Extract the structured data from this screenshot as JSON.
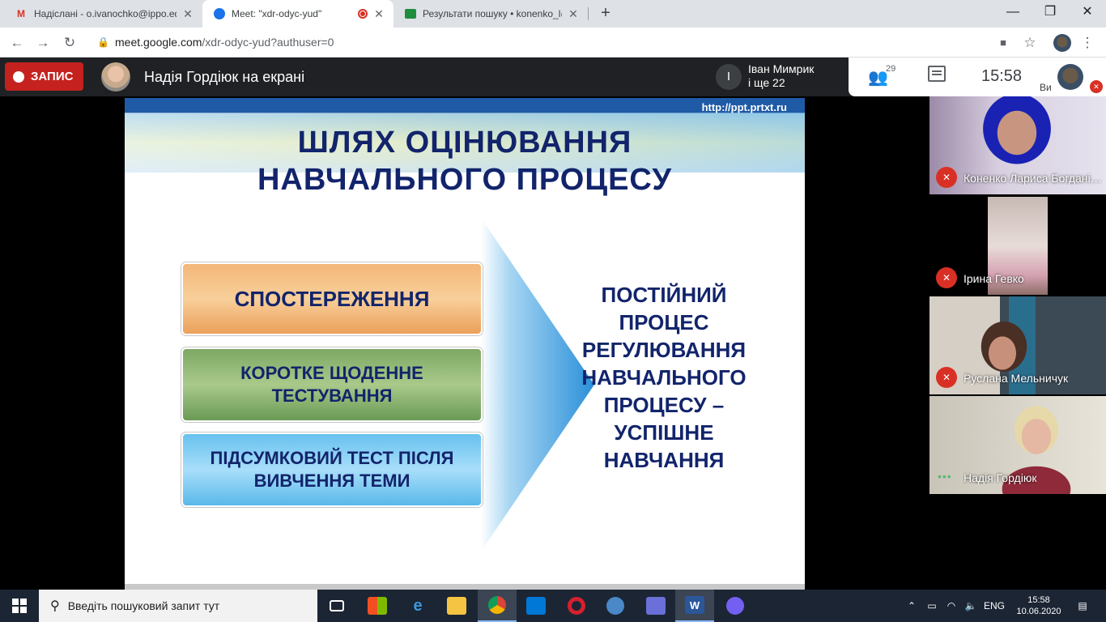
{
  "tabs": [
    {
      "title": "Надіслані - o.ivanochko@ippo.edu",
      "icon": "gmail-icon"
    },
    {
      "title": "Meet: \"xdr-odyc-yud\"",
      "icon": "meet-icon",
      "recording": true
    },
    {
      "title": "Результати пошуку • konenko_l@",
      "icon": "classroom-icon"
    }
  ],
  "address": {
    "host": "meet.google.com",
    "path": "/xdr-odyc-yud?authuser=0"
  },
  "meet": {
    "record_label": "ЗАПИС",
    "presenting_label": "Надія Гордіюк на екрані",
    "speaker_initial": "І",
    "speaker_name_line1": "Іван Мимрик",
    "speaker_name_line2": "і ще 22",
    "people_count": "29",
    "time": "15:58",
    "you_label": "Ви"
  },
  "slide": {
    "url": "http://ppt.prtxt.ru",
    "title_line1": "ШЛЯХ ОЦІНЮВАННЯ",
    "title_line2": "НАВЧАЛЬНОГО ПРОЦЕСУ",
    "box1": "СПОСТЕРЕЖЕННЯ",
    "box2_line1": "КОРОТКЕ ЩОДЕННЕ",
    "box2_line2": "ТЕСТУВАННЯ",
    "box3_line1": "ПІДСУМКОВИЙ ТЕСТ ПІСЛЯ",
    "box3_line2": "ВИВЧЕННЯ ТЕМИ",
    "result_lines": [
      "ПОСТІЙНИЙ",
      "ПРОЦЕС",
      "РЕГУЛЮВАННЯ",
      "НАВЧАЛЬНОГО",
      "ПРОЦЕСУ –",
      "УСПІШНЕ",
      "НАВЧАННЯ"
    ]
  },
  "participants": [
    {
      "name": "Коненко Лариса Богданівна",
      "muted": true
    },
    {
      "name": "Ірина Гевко",
      "muted": true
    },
    {
      "name": "Руслана Мельничук",
      "muted": true
    },
    {
      "name": "Надія Гордіюк",
      "muted": false,
      "speaking": true
    }
  ],
  "taskbar": {
    "search_placeholder": "Введіть пошуковий запит тут",
    "apps": [
      "task-view-icon",
      "store-icon",
      "edge-icon",
      "file-explorer-icon",
      "chrome-icon",
      "mail-icon",
      "opera-icon",
      "thunderbird-icon",
      "save-icon",
      "word-icon",
      "viber-icon"
    ],
    "language": "ENG",
    "time": "15:58",
    "date": "10.06.2020"
  },
  "colors": {
    "record": "#c5221f",
    "slide_title": "#12246b",
    "muted": "#d93025"
  }
}
